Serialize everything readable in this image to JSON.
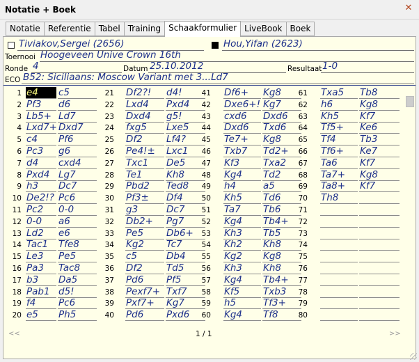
{
  "window": {
    "title": "Notatie + Boek"
  },
  "tabs": [
    "Notatie",
    "Referentie",
    "Tabel",
    "Training",
    "Schaakformulier",
    "LiveBook",
    "Boek"
  ],
  "active_tab": "Schaakformulier",
  "header": {
    "white": "Tiviakov,Sergei (2656)",
    "black": "Hou,Yifan (2623)",
    "toernooi_label": "Toernooi",
    "toernooi": "Hoogeveen Unive Crown 16th",
    "ronde_label": "Ronde",
    "ronde": "4",
    "datum_label": "Datum",
    "datum": "25.10.2012",
    "resultaat_label": "Resultaat",
    "resultaat": "1-0",
    "eco_label": "ECO",
    "eco": "B52: Siciliaans: Moscow Variant met 3...Ld7"
  },
  "moves": [
    [
      "e4",
      "c5"
    ],
    [
      "Pf3",
      "d6"
    ],
    [
      "Lb5+",
      "Ld7"
    ],
    [
      "Lxd7+",
      "Dxd7"
    ],
    [
      "c4",
      "Pf6"
    ],
    [
      "Pc3",
      "g6"
    ],
    [
      "d4",
      "cxd4"
    ],
    [
      "Pxd4",
      "Lg7"
    ],
    [
      "h3",
      "Dc7"
    ],
    [
      "De2!?",
      "Pc6"
    ],
    [
      "Pc2",
      "0-0"
    ],
    [
      "0-0",
      "a6"
    ],
    [
      "Ld2",
      "e6"
    ],
    [
      "Tac1",
      "Tfe8"
    ],
    [
      "Le3",
      "Pe5"
    ],
    [
      "Pa3",
      "Tac8"
    ],
    [
      "b3",
      "Da5"
    ],
    [
      "Pab1",
      "d5!"
    ],
    [
      "f4",
      "Pc6"
    ],
    [
      "e5",
      "Ph5"
    ],
    [
      "Df2?!",
      "d4!"
    ],
    [
      "Lxd4",
      "Pxd4"
    ],
    [
      "Dxd4",
      "g5!"
    ],
    [
      "fxg5",
      "Lxe5"
    ],
    [
      "Df2",
      "Lf4?"
    ],
    [
      "Pe4!±",
      "Lxc1"
    ],
    [
      "Txc1",
      "De5"
    ],
    [
      "Te1",
      "Kh8"
    ],
    [
      "Pbd2",
      "Ted8"
    ],
    [
      "Pf3±",
      "Df4"
    ],
    [
      "g3",
      "Dc7"
    ],
    [
      "Db2+",
      "Pg7"
    ],
    [
      "Pe5",
      "Db6+"
    ],
    [
      "Kg2",
      "Tc7"
    ],
    [
      "c5",
      "Db4"
    ],
    [
      "Df2",
      "Td5"
    ],
    [
      "Pd6",
      "Pf5"
    ],
    [
      "Pexf7+",
      "Txf7"
    ],
    [
      "Pxf7+",
      "Kg7"
    ],
    [
      "Pd6",
      "Pxd6"
    ],
    [
      "Df6+",
      "Kg8"
    ],
    [
      "Dxe6+!",
      "Kg7"
    ],
    [
      "cxd6",
      "Dxd6"
    ],
    [
      "Dxd6",
      "Txd6"
    ],
    [
      "Te7+",
      "Kg8"
    ],
    [
      "Txb7",
      "Td2+"
    ],
    [
      "Kf3",
      "Txa2"
    ],
    [
      "Kg4",
      "Td2"
    ],
    [
      "h4",
      "a5"
    ],
    [
      "Kh5",
      "Td6"
    ],
    [
      "Ta7",
      "Tb6"
    ],
    [
      "Kg4",
      "Tb4+"
    ],
    [
      "Kh3",
      "Tb5"
    ],
    [
      "Kh2",
      "Kh8"
    ],
    [
      "Kg2",
      "Kg8"
    ],
    [
      "Kh3",
      "Kh8"
    ],
    [
      "Kg4",
      "Tb4+"
    ],
    [
      "Kf5",
      "Txb3"
    ],
    [
      "h5",
      "Tf3+"
    ],
    [
      "Kg4",
      "Tf8"
    ],
    [
      "Txa5",
      "Tb8"
    ],
    [
      "h6",
      "Kg8"
    ],
    [
      "Kh5",
      "Kf7"
    ],
    [
      "Tf5+",
      "Ke6"
    ],
    [
      "Tf4",
      "Tb3"
    ],
    [
      "Tf6+",
      "Ke7"
    ],
    [
      "Ta6",
      "Kf7"
    ],
    [
      "Ta7+",
      "Kg8"
    ],
    [
      "Ta8+",
      "Kf7"
    ],
    [
      "Th8",
      ""
    ]
  ],
  "selected_move": "e4",
  "pager": {
    "prev": "<<",
    "next": ">>",
    "page": "1 / 1"
  }
}
